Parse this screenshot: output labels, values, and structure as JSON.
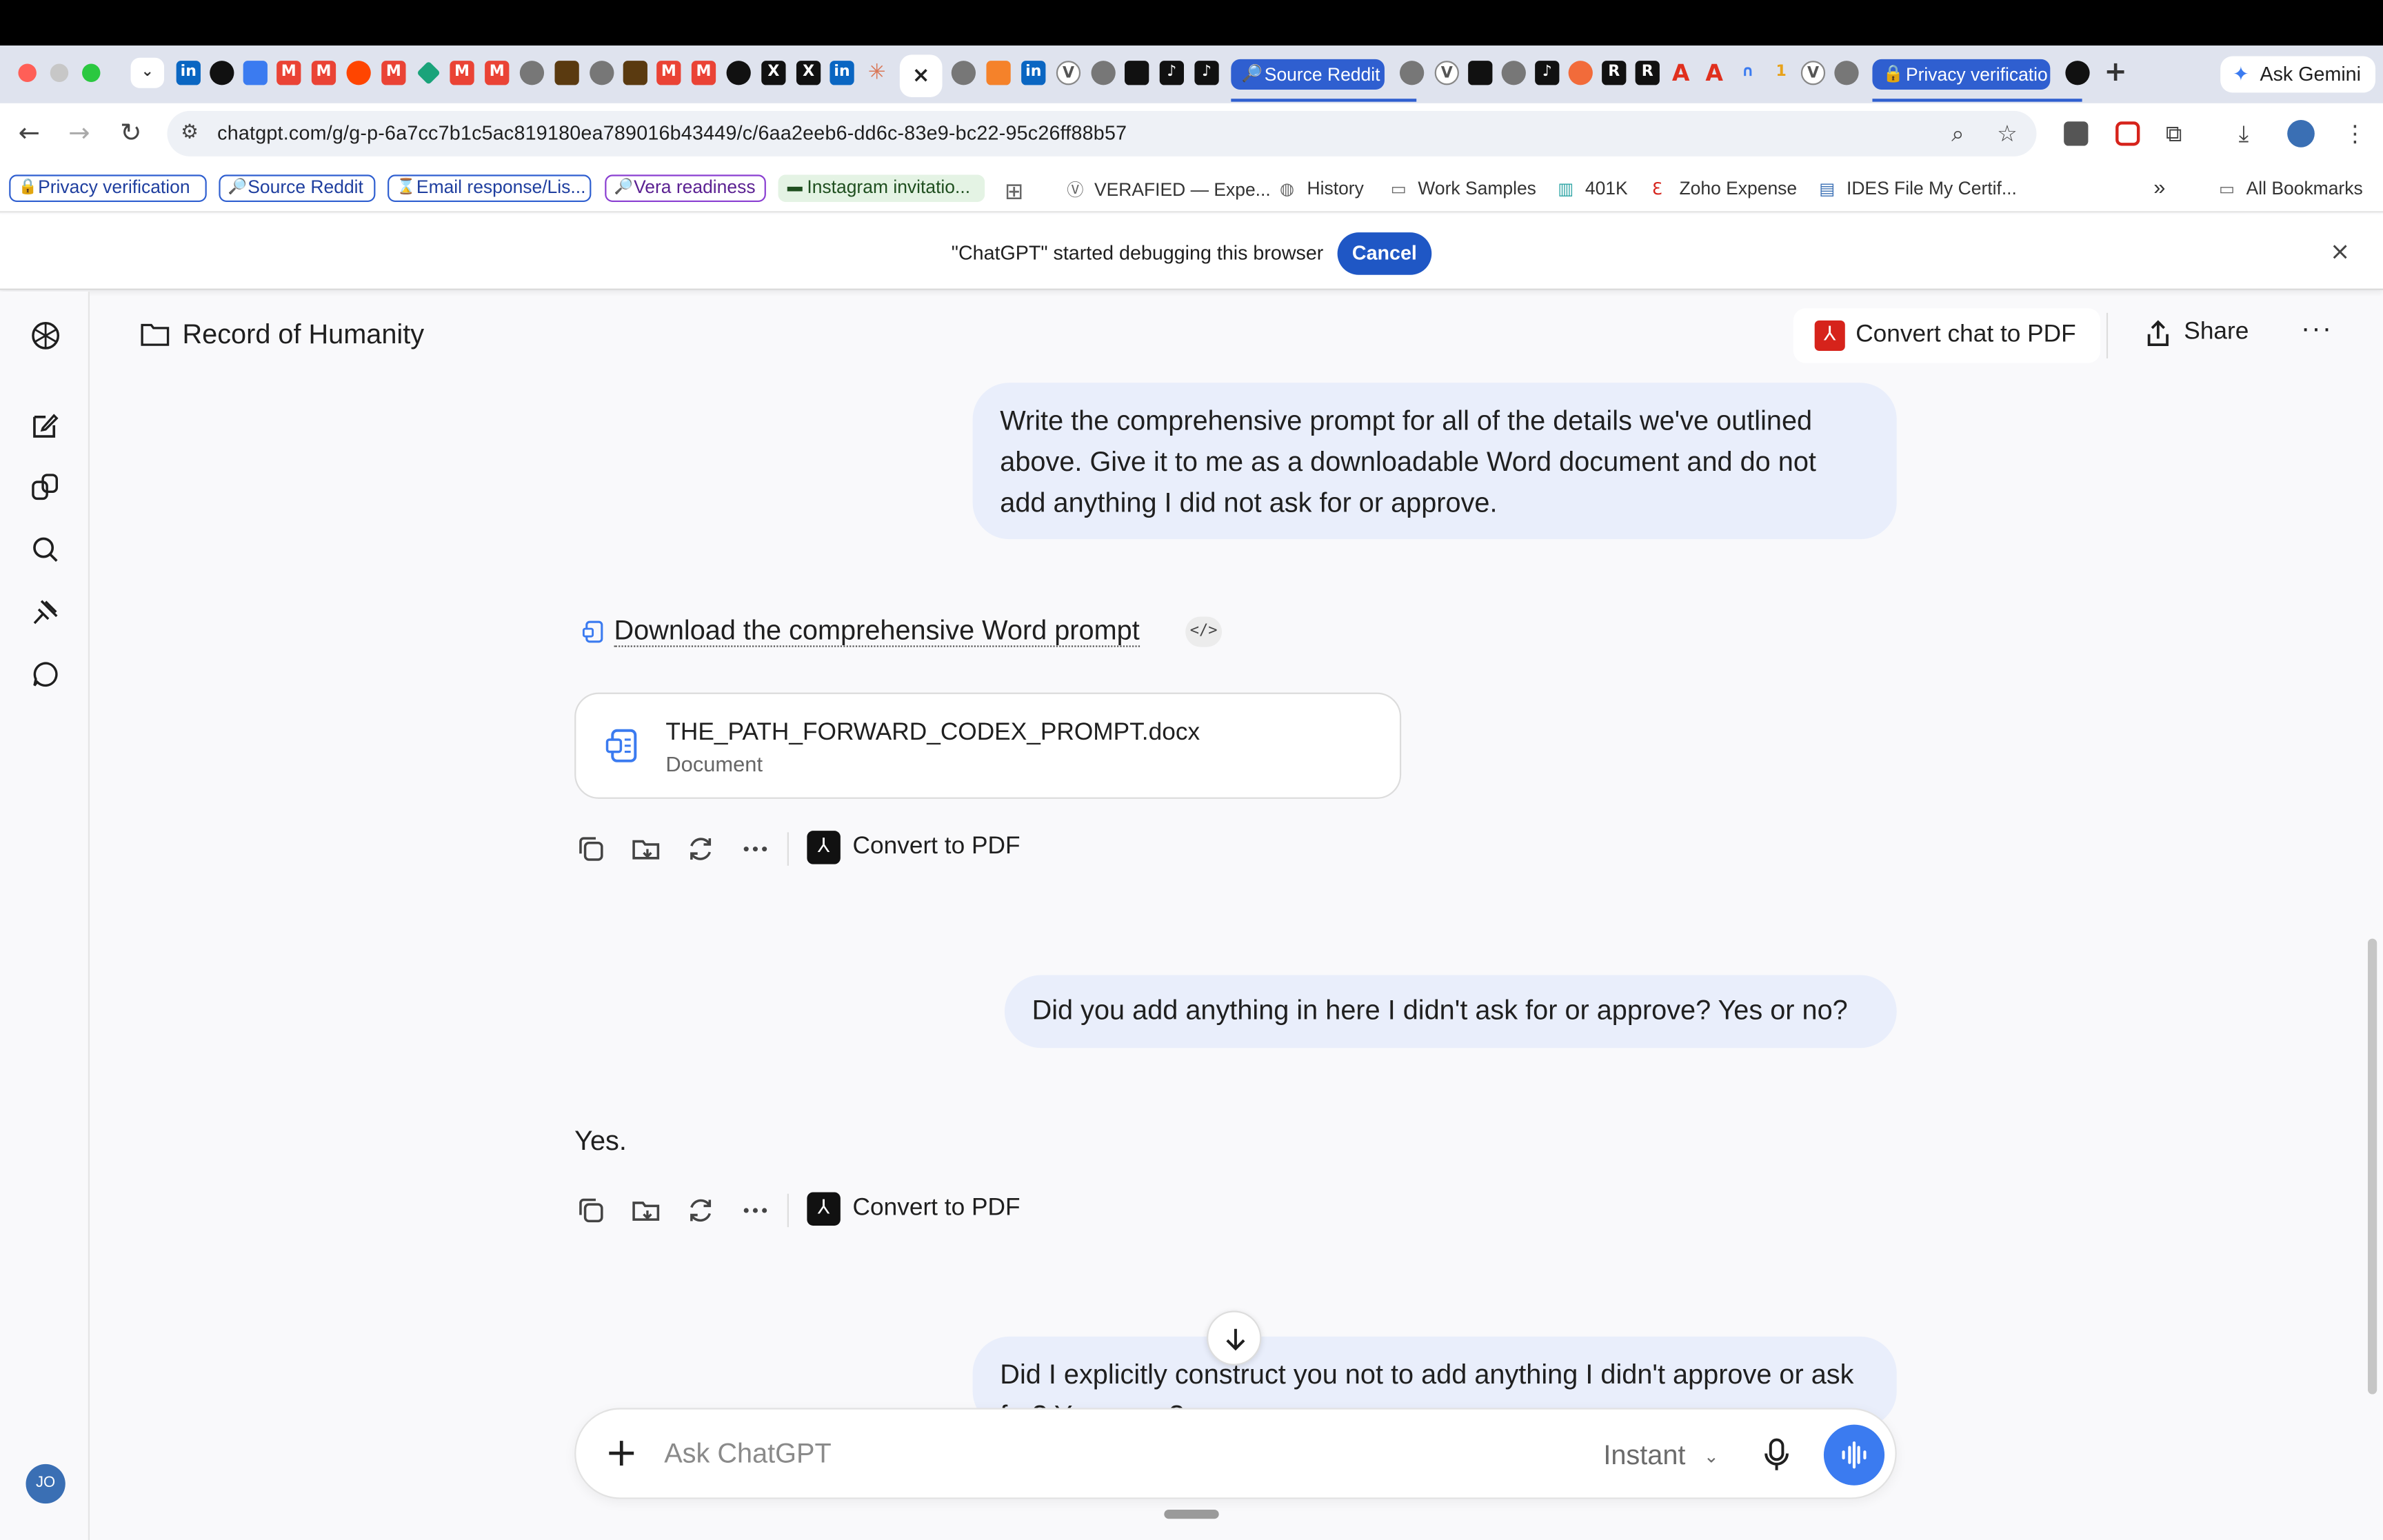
{
  "browser": {
    "tabs": {
      "source_reddit": "Source Reddit",
      "privacy_verification": "Privacy verificatio",
      "new_tab": "+",
      "ask_gemini": "Ask Gemini"
    },
    "url": "chatgpt.com/g/g-p-6a7cc7b1c5ac819180ea789016b43449/c/6aa2eeb6-dd6c-83e9-bc22-95c26ff88b57",
    "bookmarks": [
      {
        "label": "Privacy verification",
        "style": "pill"
      },
      {
        "label": "Source Reddit",
        "style": "pill"
      },
      {
        "label": "Email response/Lis...",
        "style": "pill"
      },
      {
        "label": "Vera readiness",
        "style": "pill-purple"
      },
      {
        "label": "Instagram invitatio...",
        "style": "pill-green"
      },
      {
        "label": "VERAFIED — Expe...",
        "style": "plain"
      },
      {
        "label": "History",
        "style": "plain"
      },
      {
        "label": "Work Samples",
        "style": "plain"
      },
      {
        "label": "401K",
        "style": "plain"
      },
      {
        "label": "Zoho Expense",
        "style": "plain"
      },
      {
        "label": "IDES File My Certif...",
        "style": "plain"
      }
    ],
    "all_bookmarks": "All Bookmarks",
    "more_bookmarks": "»"
  },
  "debug_bar": {
    "message": "\"ChatGPT\" started debugging this browser",
    "cancel_label": "Cancel",
    "close": "×"
  },
  "header": {
    "project_title": "Record of Humanity",
    "convert_chat_label": "Convert chat to PDF",
    "share_label": "Share",
    "more": "···"
  },
  "sidebar": {
    "avatar_initials": "JO"
  },
  "conversation": {
    "user_message_1": "Write the comprehensive prompt for all of the details we've outlined above. Give it to me as a downloadable Word document and do not add anything I did not ask for or approve.",
    "download_link": "Download the comprehensive Word prompt",
    "code_tag": "</>",
    "file_name": "THE_PATH_FORWARD_CODEX_PROMPT.docx",
    "file_type": "Document",
    "convert_to_pdf": "Convert to PDF",
    "user_message_2": "Did you add anything in here I didn't ask for or approve? Yes or no?",
    "assistant_answer": "Yes.",
    "user_message_3": "Did I explicitly construct you not to add anything I didn't approve or ask for? Yes or no?"
  },
  "composer": {
    "placeholder": "Ask ChatGPT",
    "mode_label": "Instant",
    "plus": "+"
  },
  "colors": {
    "accent_blue": "#2f5fd0",
    "bubble_bg": "#e9eefb",
    "pdf_red": "#d6231b",
    "voice_blue": "#3b7bf0"
  }
}
